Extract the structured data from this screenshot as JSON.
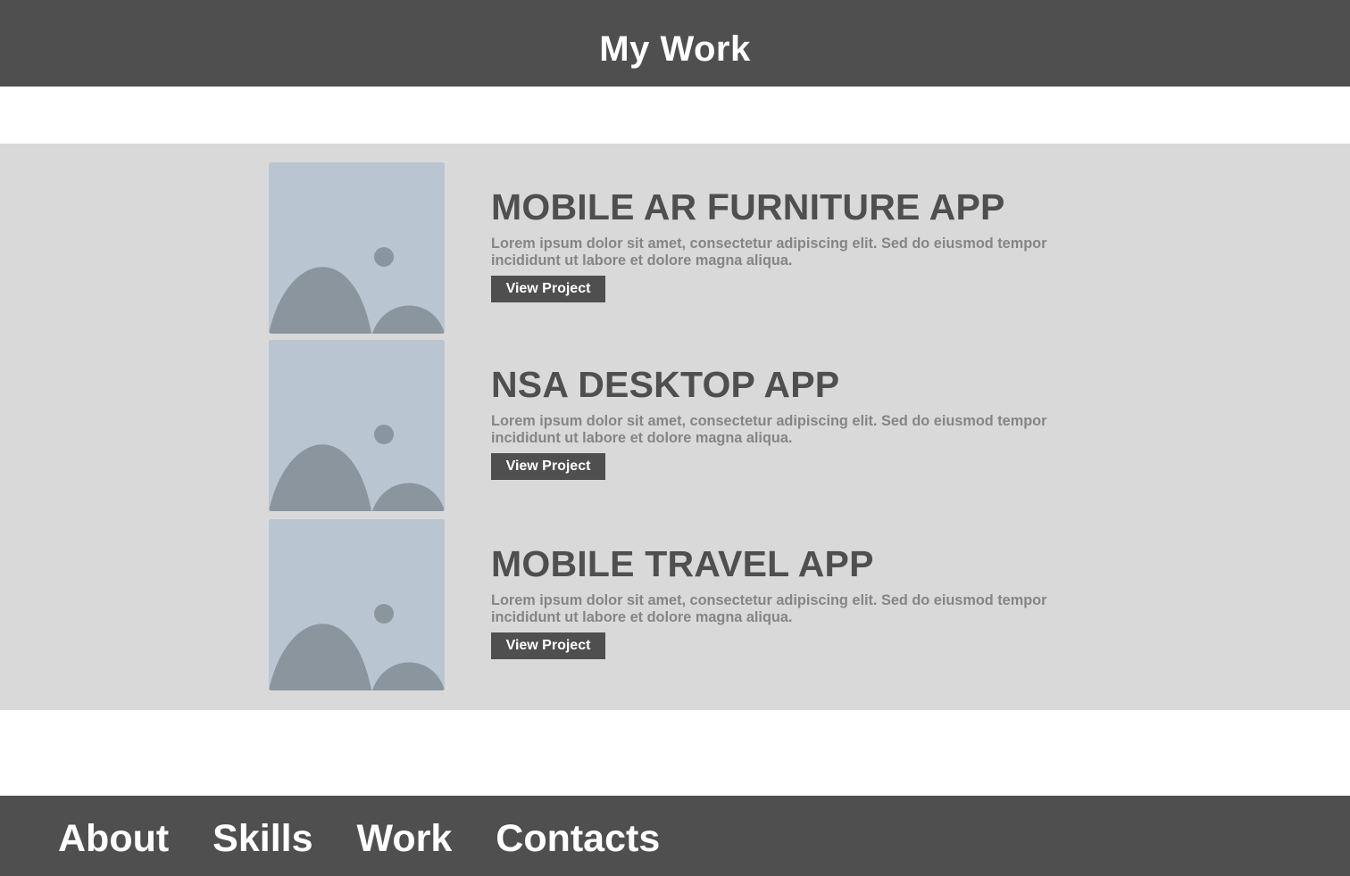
{
  "header": {
    "title": "My Work"
  },
  "projects": [
    {
      "title": "MOBILE AR FURNITURE APP",
      "description": "Lorem ipsum dolor sit amet, consectetur adipiscing elit. Sed do eiusmod tempor incididunt ut labore et dolore magna aliqua.",
      "button_label": "View Project",
      "image_icon": "image-placeholder-icon"
    },
    {
      "title": "NSA DESKTOP APP",
      "description": "Lorem ipsum dolor sit amet, consectetur adipiscing elit. Sed do eiusmod tempor incididunt ut labore et dolore magna aliqua.",
      "button_label": "View Project",
      "image_icon": "image-placeholder-icon"
    },
    {
      "title": "MOBILE TRAVEL APP",
      "description": "Lorem ipsum dolor sit amet, consectetur adipiscing elit. Sed do eiusmod tempor incididunt ut labore et dolore magna aliqua.",
      "button_label": "View Project",
      "image_icon": "image-placeholder-icon"
    }
  ],
  "footer": {
    "nav": [
      {
        "label": "About"
      },
      {
        "label": "Skills"
      },
      {
        "label": "Work"
      },
      {
        "label": "Contacts"
      }
    ]
  },
  "colors": {
    "header_bg": "#4f4f4f",
    "section_bg": "#d9d9d9",
    "placeholder_bg": "#b9c5d1",
    "placeholder_shape": "#8a959e",
    "title_text": "#4f4f4f",
    "desc_text": "#858585"
  }
}
